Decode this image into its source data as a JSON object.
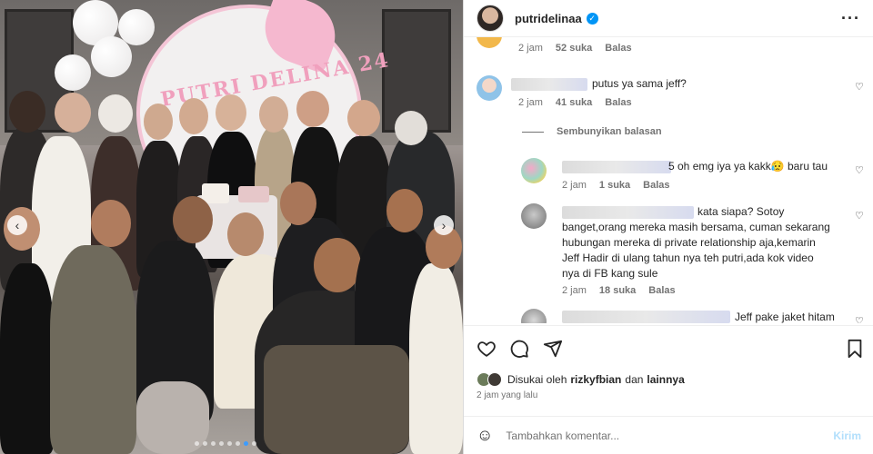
{
  "post": {
    "username": "putridelinaa",
    "more_icon": "more-horizontal-icon",
    "verified_icon": "verified-badge-icon"
  },
  "photo": {
    "banner_text": "PUTRI DELINA 24",
    "slide_count": 8,
    "active_slide": 6
  },
  "comments": {
    "top_meta": {
      "time": "2 jam",
      "likes": "52 suka",
      "reply": "Balas"
    },
    "c1": {
      "text": "putus ya sama jeff?",
      "time": "2 jam",
      "likes": "41 suka",
      "reply": "Balas"
    },
    "hide_replies": "Sembunyikan balasan",
    "r1": {
      "text": "5 oh emg iya ya kakk😥 baru tau",
      "time": "2 jam",
      "likes": "1 suka",
      "reply": "Balas"
    },
    "r2": {
      "line1": "kata siapa? Sotoy",
      "line2": "banget,orang mereka masih bersama, cuman sekarang",
      "line3": "hubungan mereka di private relationship aja,kemarin",
      "line4": "Jeff Hadir di ulang tahun nya teh putri,ada kok video",
      "line5": "nya di FB kang sule",
      "time": "2 jam",
      "likes": "18 suka",
      "reply": "Balas"
    },
    "r3": {
      "text": "Jeff pake jaket hitam"
    }
  },
  "actions": {
    "like_icon": "heart-icon",
    "comment_icon": "comment-icon",
    "share_icon": "send-icon",
    "save_icon": "bookmark-icon"
  },
  "likes": {
    "prefix": "Disukai oleh",
    "user": "rizkyfbian",
    "middle": "dan",
    "suffix": "lainnya"
  },
  "posted_ago": "2 jam yang lalu",
  "add_comment": {
    "placeholder": "Tambahkan komentar...",
    "post_label": "Kirim"
  }
}
